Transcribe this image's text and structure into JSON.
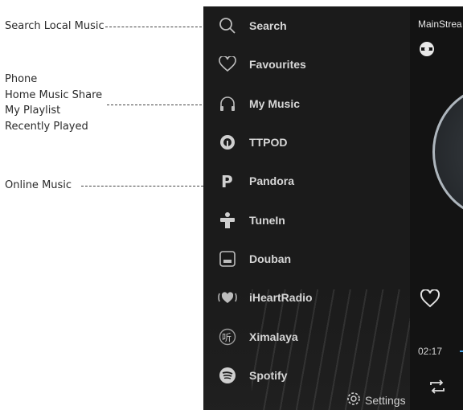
{
  "annotations": {
    "search_local": "Search Local Music",
    "my_music_lines": [
      "Phone",
      "Home Music Share",
      "My Playlist",
      "Recently Played"
    ],
    "online": "Online Music"
  },
  "drawer": {
    "items": [
      {
        "label": "Search",
        "icon": "search-icon"
      },
      {
        "label": "Favourites",
        "icon": "heart-icon"
      },
      {
        "label": "My Music",
        "icon": "headphones-icon"
      },
      {
        "label": "TTPOD",
        "icon": "ttpod-icon"
      },
      {
        "label": "Pandora",
        "icon": "pandora-icon"
      },
      {
        "label": "TuneIn",
        "icon": "tunein-icon"
      },
      {
        "label": "Douban",
        "icon": "douban-icon"
      },
      {
        "label": "iHeartRadio",
        "icon": "iheartradio-icon"
      },
      {
        "label": "Ximalaya",
        "icon": "ximalaya-icon"
      },
      {
        "label": "Spotify",
        "icon": "spotify-icon"
      }
    ],
    "settings_label": "Settings"
  },
  "player": {
    "source_label": "MainStrea",
    "elapsed_time": "02:17"
  },
  "colors": {
    "drawer_bg": "#1b1b1b",
    "accent": "#4aa3e6"
  }
}
